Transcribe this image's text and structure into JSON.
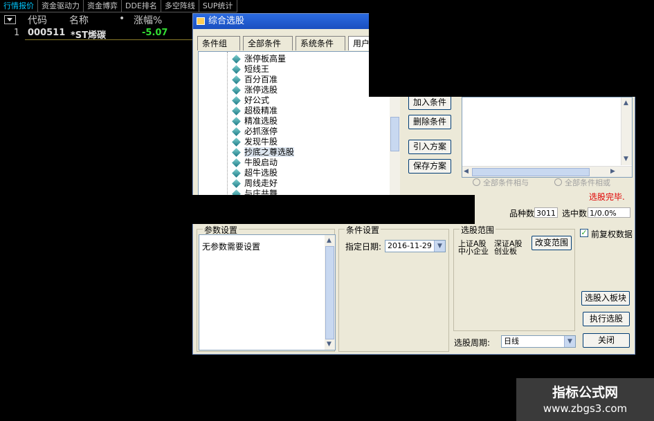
{
  "top_tabs": [
    "行情报价",
    "资金驱动力",
    "资金博弈",
    "DDE排名",
    "多空阵线",
    "SUP统计"
  ],
  "list": {
    "headers": {
      "code": "代码",
      "name": "名称",
      "dot": "•",
      "change": "涨幅%"
    },
    "rows": [
      {
        "index": "1",
        "code": "000511",
        "name": "*ST烯碳",
        "change": "-5.07"
      }
    ]
  },
  "dialog": {
    "title": "综合选股",
    "tabs": [
      "条件组",
      "全部条件",
      "系统条件",
      "用户条件"
    ],
    "tree_items": [
      "涨停板高量",
      "短线王",
      "百分百准",
      "涨停选股",
      "好公式",
      "超极精准",
      "精准选股",
      "必抓涨停",
      "发现牛股",
      "抄底之尊选股",
      "牛股启动",
      "超牛选股",
      "周线走好",
      "与庄共舞"
    ],
    "selected_item": "抄底之尊选股",
    "buttons": {
      "add": "加入条件",
      "delete": "删除条件",
      "import": "引入方案",
      "save": "保存方案"
    },
    "radio_and": "全部条件相与",
    "radio_or": "全部条件相或",
    "status": "选股完毕.",
    "count_label": "品种数",
    "count_value": "3011",
    "selected_label": "选中数",
    "selected_value": "1/0.0%",
    "params": {
      "title": "参数设置",
      "text": "无参数需要设置"
    },
    "condition": {
      "title": "条件设置",
      "date_label": "指定日期:",
      "date_value": "2016-11-29"
    },
    "range": {
      "title": "选股范围",
      "items": [
        "上证A股",
        "深证A股",
        "中小企业",
        "创业板"
      ],
      "change_button": "改变范围"
    },
    "period_label": "选股周期:",
    "period_value": "日线",
    "restore_label": "前复权数据",
    "restore_checked": true,
    "to_block_button": "选股入板块",
    "execute_button": "执行选股",
    "close_button": "关闭"
  },
  "watermark": {
    "title": "指标公式网",
    "url": "www.zbgs3.com"
  },
  "colors": {
    "background": "#000000",
    "header_text": "#c8c8c8",
    "active_tab": "#00c8ff",
    "stock_code": "#e0e0e0",
    "stock_name": "#e0e0e0",
    "negative": "#33dd33",
    "dialog_bg": "#ece9d8",
    "titlebar": "#1a4fc0",
    "status_red": "#e00000"
  }
}
